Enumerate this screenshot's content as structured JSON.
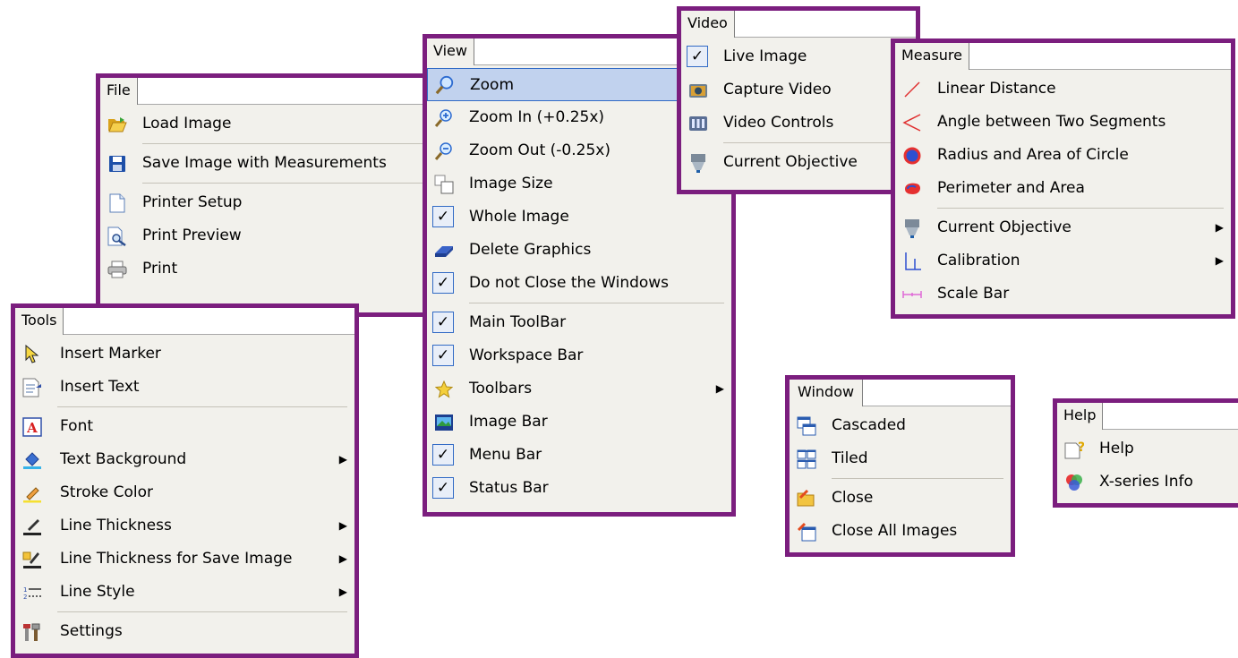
{
  "colors": {
    "frame": "#7b1e7e",
    "menu_bg": "#f2f1ec",
    "highlight": "#c1d2ee",
    "highlight_border": "#316ac5"
  },
  "file_menu": {
    "title": "File",
    "items": [
      {
        "label": "Load Image",
        "icon": "folder-open-icon"
      },
      {
        "label": "Save Image with Measurements",
        "icon": "floppy-disk-icon"
      },
      {
        "label": "Printer Setup",
        "icon": "page-icon"
      },
      {
        "label": "Print Preview",
        "icon": "print-preview-icon"
      },
      {
        "label": "Print",
        "icon": "printer-icon"
      }
    ]
  },
  "view_menu": {
    "title": "View",
    "items": [
      {
        "label": "Zoom",
        "icon": "magnifier-icon",
        "highlighted": true
      },
      {
        "label": "Zoom In (+0.25x)",
        "icon": "zoom-in-icon"
      },
      {
        "label": "Zoom Out (-0.25x)",
        "icon": "zoom-out-icon"
      },
      {
        "label": "Image Size",
        "icon": "image-size-icon"
      },
      {
        "label": "Whole Image",
        "checked": true
      },
      {
        "label": "Delete Graphics",
        "icon": "eraser-icon"
      },
      {
        "label": "Do not Close the Windows",
        "checked": true
      },
      {
        "label": "Main ToolBar",
        "checked": true
      },
      {
        "label": "Workspace Bar",
        "checked": true
      },
      {
        "label": "Toolbars",
        "icon": "star-icon",
        "submenu": true
      },
      {
        "label": "Image Bar",
        "icon": "image-bar-icon"
      },
      {
        "label": "Menu Bar",
        "checked": true
      },
      {
        "label": "Status Bar",
        "checked": true
      }
    ]
  },
  "video_menu": {
    "title": "Video",
    "items": [
      {
        "label": "Live Image",
        "checked": true
      },
      {
        "label": "Capture Video",
        "icon": "camera-icon"
      },
      {
        "label": "Video Controls",
        "icon": "video-controls-icon"
      },
      {
        "label": "Current Objective",
        "icon": "objective-icon"
      }
    ]
  },
  "measure_menu": {
    "title": "Measure",
    "items": [
      {
        "label": "Linear Distance",
        "icon": "line-icon"
      },
      {
        "label": "Angle between Two Segments",
        "icon": "angle-icon"
      },
      {
        "label": "Radius and Area of Circle",
        "icon": "circle-icon"
      },
      {
        "label": "Perimeter and Area",
        "icon": "perimeter-icon"
      },
      {
        "label": "Current Objective",
        "icon": "objective-icon",
        "submenu": true
      },
      {
        "label": "Calibration",
        "icon": "calibration-icon",
        "submenu": true
      },
      {
        "label": "Scale Bar",
        "icon": "scale-bar-icon"
      }
    ]
  },
  "tools_menu": {
    "title": "Tools",
    "items": [
      {
        "label": "Insert Marker",
        "icon": "cursor-icon"
      },
      {
        "label": "Insert Text",
        "icon": "text-icon"
      },
      {
        "label": "Font",
        "icon": "font-icon"
      },
      {
        "label": "Text Background",
        "icon": "paint-bucket-icon",
        "submenu": true
      },
      {
        "label": "Stroke Color",
        "icon": "pencil-icon"
      },
      {
        "label": "Line Thickness",
        "icon": "line-thickness-icon",
        "submenu": true
      },
      {
        "label": "Line Thickness for Save Image",
        "icon": "line-thickness-save-icon",
        "submenu": true
      },
      {
        "label": "Line Style",
        "icon": "line-style-icon",
        "submenu": true
      },
      {
        "label": "Settings",
        "icon": "tools-icon"
      }
    ]
  },
  "window_menu": {
    "title": "Window",
    "items": [
      {
        "label": "Cascaded",
        "icon": "cascade-icon"
      },
      {
        "label": "Tiled",
        "icon": "tile-icon"
      },
      {
        "label": "Close",
        "icon": "close-folder-icon"
      },
      {
        "label": "Close All Images",
        "icon": "close-all-icon"
      }
    ]
  },
  "help_menu": {
    "title": "Help",
    "items": [
      {
        "label": "Help",
        "icon": "help-icon"
      },
      {
        "label": "X-series Info",
        "icon": "info-icon"
      }
    ]
  },
  "glyphs": {
    "check": "✓",
    "submenu_arrow": "▶"
  }
}
